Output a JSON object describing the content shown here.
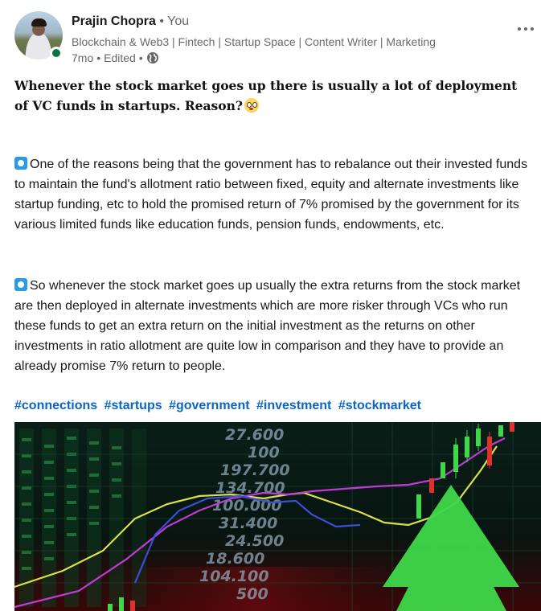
{
  "author": {
    "name": "Prajin Chopra",
    "separator": "•",
    "relation": "You",
    "headline": "Blockchain & Web3 | Fintech | Startup Space | Content Writer | Marketing",
    "age": "7mo",
    "edited": "Edited",
    "visibility_icon": "globe-icon",
    "status_color": "#057642"
  },
  "post": {
    "title": "Whenever the stock market goes up there is usually a lot of deployment of VC funds in startups. Reason?",
    "paragraph_1": "One of the reasons being that the government has to rebalance out their invested funds to maintain the fund's allotment ratio between fixed, equity and alternate investments like startup funding, etc to hold the promised return of 7% promised by the government for its various limited funds like education funds, pension funds, endowments, etc.",
    "paragraph_2": "So whenever the stock market goes up usually the extra returns from the stock market are then deployed in alternate investments which are more risker through VCs who run these funds to get an extra return on the initial investment as the returns on other investments in ratio allotment are quite low in comparison and they have to provide an already promise 7% return to people.",
    "hashtags": [
      "#connections",
      "#startups",
      "#government",
      "#investment",
      "#stockmarket"
    ]
  },
  "image": {
    "numbers": [
      "27.600",
      "100",
      "197.700",
      "134.700",
      "100.000",
      "31.400",
      "24.500",
      "18.600",
      "104.100",
      "500"
    ],
    "accent_green": "#3fd84a",
    "line_colors": [
      "#d8e04a",
      "#c23ad6",
      "#3a4fd6"
    ]
  },
  "colors": {
    "link": "#0a66c2",
    "bullet": "#2c9be6"
  }
}
